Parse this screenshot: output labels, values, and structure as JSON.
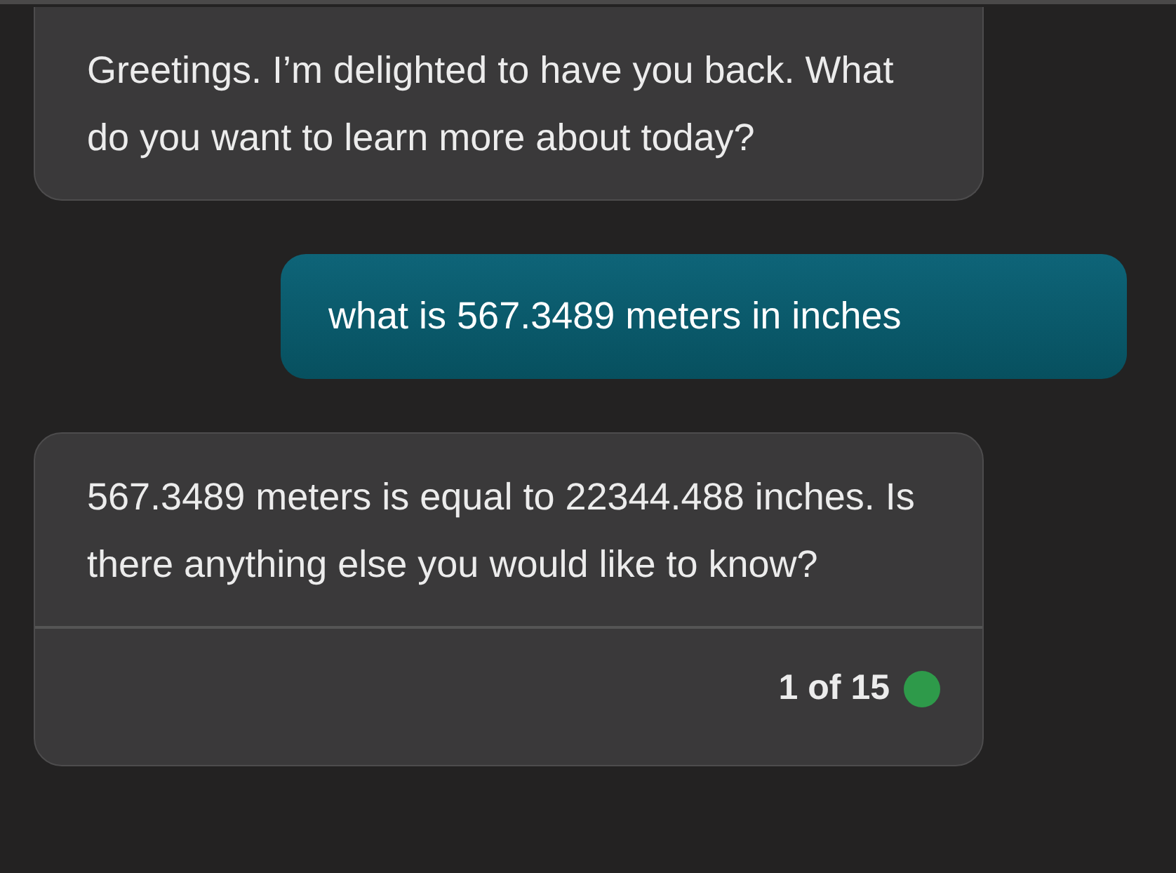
{
  "messages": [
    {
      "kind": "bot",
      "text": "Greetings. I’m delighted to have you back. What do you want to learn more about today?"
    },
    {
      "kind": "user",
      "text": "what is 567.3489 meters in inches"
    },
    {
      "kind": "bot",
      "text": "567.3489 meters is equal to 22344.488 inches. Is there anything else you would like to know?",
      "footer": {
        "counter": "1 of 15",
        "color": "#2e9a4a"
      }
    }
  ]
}
